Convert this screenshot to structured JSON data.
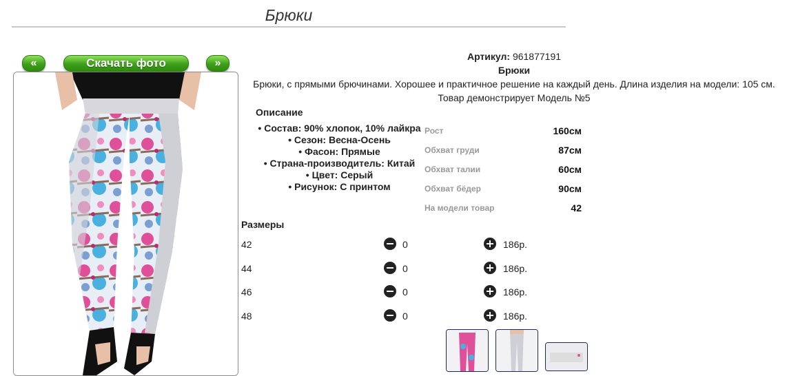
{
  "page": {
    "title": "Брюки"
  },
  "gallery": {
    "prev_label": "«",
    "next_label": "»",
    "download_label": "Скачать фото"
  },
  "product": {
    "article_label": "Артикул:",
    "article_value": "961877191",
    "name": "Брюки",
    "description": "Брюки, с прямыми брючинами. Хорошее и практичное решение на каждый день. Длина изделия на модели: 105 см.",
    "model_note": "Товар демонстрирует Модель №5"
  },
  "description_block": {
    "heading": "Описание",
    "properties": [
      "Состав: 90% хлопок, 10% лайкра",
      "Сезон: Весна-Осень",
      "Фасон: Прямые",
      "Страна-производитель: Китай",
      "Цвет: Серый",
      "Рисунок: С принтом"
    ]
  },
  "measurements": [
    {
      "label": "Рост",
      "value": "160см"
    },
    {
      "label": "Обхват груди",
      "value": "87см"
    },
    {
      "label": "Обхват талии",
      "value": "60см"
    },
    {
      "label": "Обхват бёдер",
      "value": "90см"
    },
    {
      "label": "На модели товар",
      "value": "42"
    }
  ],
  "sizes": {
    "heading": "Размеры",
    "rows": [
      {
        "size": "42",
        "qty": "0",
        "price": "186р."
      },
      {
        "size": "44",
        "qty": "0",
        "price": "186р."
      },
      {
        "size": "46",
        "qty": "0",
        "price": "186р."
      },
      {
        "size": "48",
        "qty": "0",
        "price": "186р."
      }
    ]
  },
  "icons": {
    "minus": "minus-circle-icon",
    "plus": "plus-circle-icon"
  },
  "colors": {
    "accent_green": "#3ea01a",
    "pink": "#e0509a",
    "blue": "#4ab0e0",
    "grey": "#d8d8dc"
  }
}
